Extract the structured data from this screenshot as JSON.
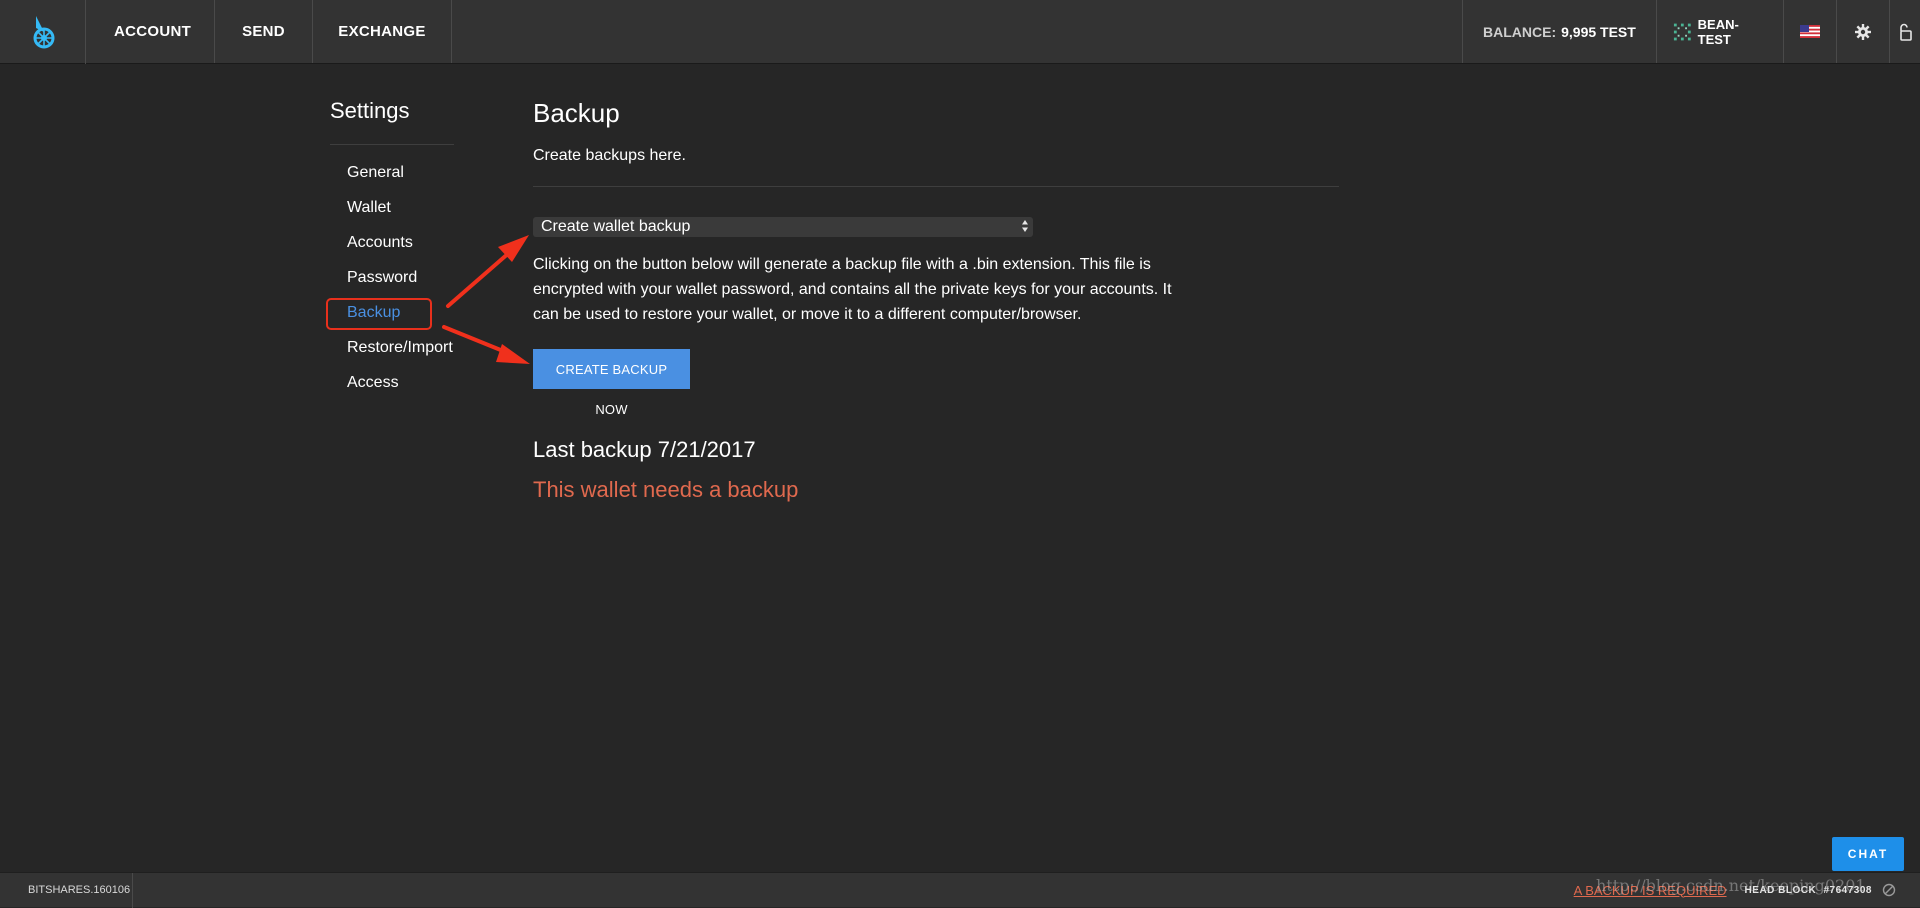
{
  "topbar": {
    "nav": {
      "account": "ACCOUNT",
      "send": "SEND",
      "exchange": "EXCHANGE"
    },
    "balance_label": "BALANCE:",
    "balance_value": "9,995 TEST",
    "account_name": "BEAN-TEST",
    "icons": {
      "logo": "bitshares-logo-icon",
      "flag": "us-flag-icon",
      "settings": "gear-icon",
      "lock": "unlock-icon"
    }
  },
  "sidebar": {
    "title": "Settings",
    "items": [
      {
        "label": "General"
      },
      {
        "label": "Wallet"
      },
      {
        "label": "Accounts"
      },
      {
        "label": "Password"
      },
      {
        "label": "Backup",
        "active": true
      },
      {
        "label": "Restore/Import"
      },
      {
        "label": "Access"
      }
    ]
  },
  "main": {
    "title": "Backup",
    "description": "Create backups here.",
    "select_value": "Create wallet backup",
    "info_text": "Clicking on the button below will generate a backup file with a .bin extension. This file is encrypted with your wallet password, and contains all the private keys for your accounts. It can be used to restore your wallet, or move it to a different computer/browser.",
    "button_label": "CREATE BACKUP NOW",
    "last_backup": "Last backup 7/21/2017",
    "warning": "This wallet needs a backup"
  },
  "chat_label": "CHAT",
  "footer": {
    "version": "BITSHARES.160106",
    "backup_required": "A BACKUP IS REQUIRED",
    "head_block_label": "HEAD BLOCK",
    "head_block_value": "#7647308"
  },
  "watermark": "http://blog.csdn.net/keeping0201",
  "colors": {
    "background": "#262626",
    "bar": "#333333",
    "accent": "#4a90e2",
    "warning": "#e0694e",
    "annotation": "#e8301c",
    "chat": "#1e8fe9"
  }
}
